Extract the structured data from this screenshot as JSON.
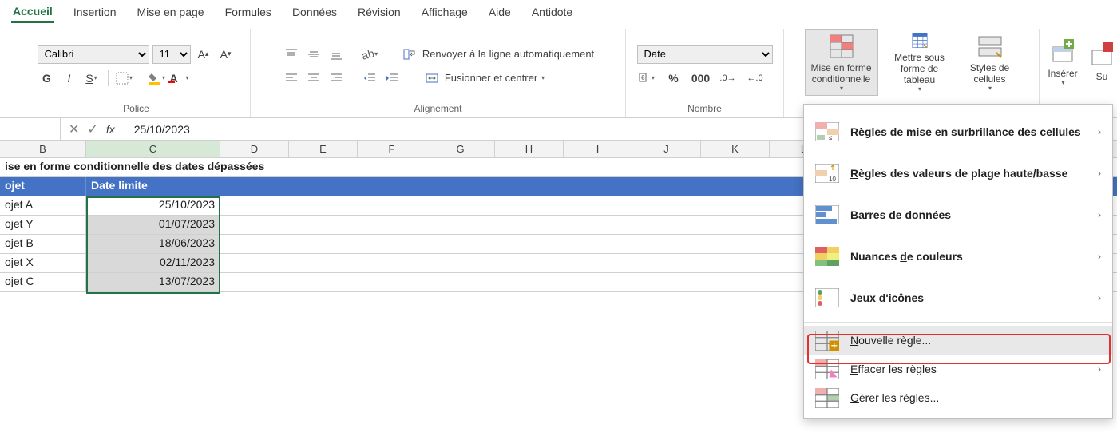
{
  "ribbon": {
    "tabs": [
      "Accueil",
      "Insertion",
      "Mise en page",
      "Formules",
      "Données",
      "Révision",
      "Affichage",
      "Aide",
      "Antidote"
    ],
    "active_tab": "Accueil",
    "groups": {
      "police": {
        "label": "Police",
        "font_name": "Calibri",
        "font_size": "11",
        "bold": "G",
        "italic": "I",
        "underline": "S"
      },
      "alignement": {
        "label": "Alignement",
        "wrap": "Renvoyer à la ligne automatiquement",
        "merge": "Fusionner et centrer"
      },
      "nombre": {
        "label": "Nombre",
        "format": "Date"
      },
      "styles": {
        "cond_format": "Mise en forme conditionnelle",
        "table_format": "Mettre sous forme de tableau",
        "cell_styles": "Styles de cellules"
      },
      "cellules": {
        "insert": "Insérer",
        "su": "Su"
      }
    }
  },
  "formula_bar": {
    "fx": "fx",
    "value": "25/10/2023"
  },
  "grid": {
    "columns": [
      "B",
      "C",
      "D",
      "E",
      "F",
      "G",
      "H",
      "I",
      "J",
      "K",
      "L"
    ],
    "selected_col": "C",
    "title": "ise en forme conditionnelle des dates dépassées",
    "headers": {
      "b": "ojet",
      "c": "Date limite"
    },
    "rows": [
      {
        "b": "ojet A",
        "c": "25/10/2023"
      },
      {
        "b": "ojet Y",
        "c": "01/07/2023"
      },
      {
        "b": "ojet B",
        "c": "18/06/2023"
      },
      {
        "b": "ojet X",
        "c": "02/11/2023"
      },
      {
        "b": "ojet C",
        "c": "13/07/2023"
      }
    ]
  },
  "dropdown": {
    "items": [
      {
        "icon": "highlight-rules-icon",
        "label": "Règles de mise en surbrillance des cellules",
        "submenu": true,
        "u": "b"
      },
      {
        "icon": "top-bottom-icon",
        "label": "Règles des valeurs de plage haute/basse",
        "submenu": true,
        "u": "R"
      },
      {
        "icon": "data-bars-icon",
        "label": "Barres de données",
        "submenu": true,
        "u": "d"
      },
      {
        "icon": "color-scales-icon",
        "label": "Nuances de couleurs",
        "submenu": true,
        "u": "d"
      },
      {
        "icon": "icon-sets-icon",
        "label": "Jeux d'icônes",
        "submenu": true,
        "u": "i"
      },
      {
        "icon": "new-rule-icon",
        "label": "Nouvelle règle...",
        "submenu": false,
        "highlighted": true,
        "u": "N"
      },
      {
        "icon": "clear-rules-icon",
        "label": "Effacer les règles",
        "submenu": true,
        "u": "E"
      },
      {
        "icon": "manage-rules-icon",
        "label": "Gérer les règles...",
        "submenu": false,
        "u": "G"
      }
    ]
  }
}
